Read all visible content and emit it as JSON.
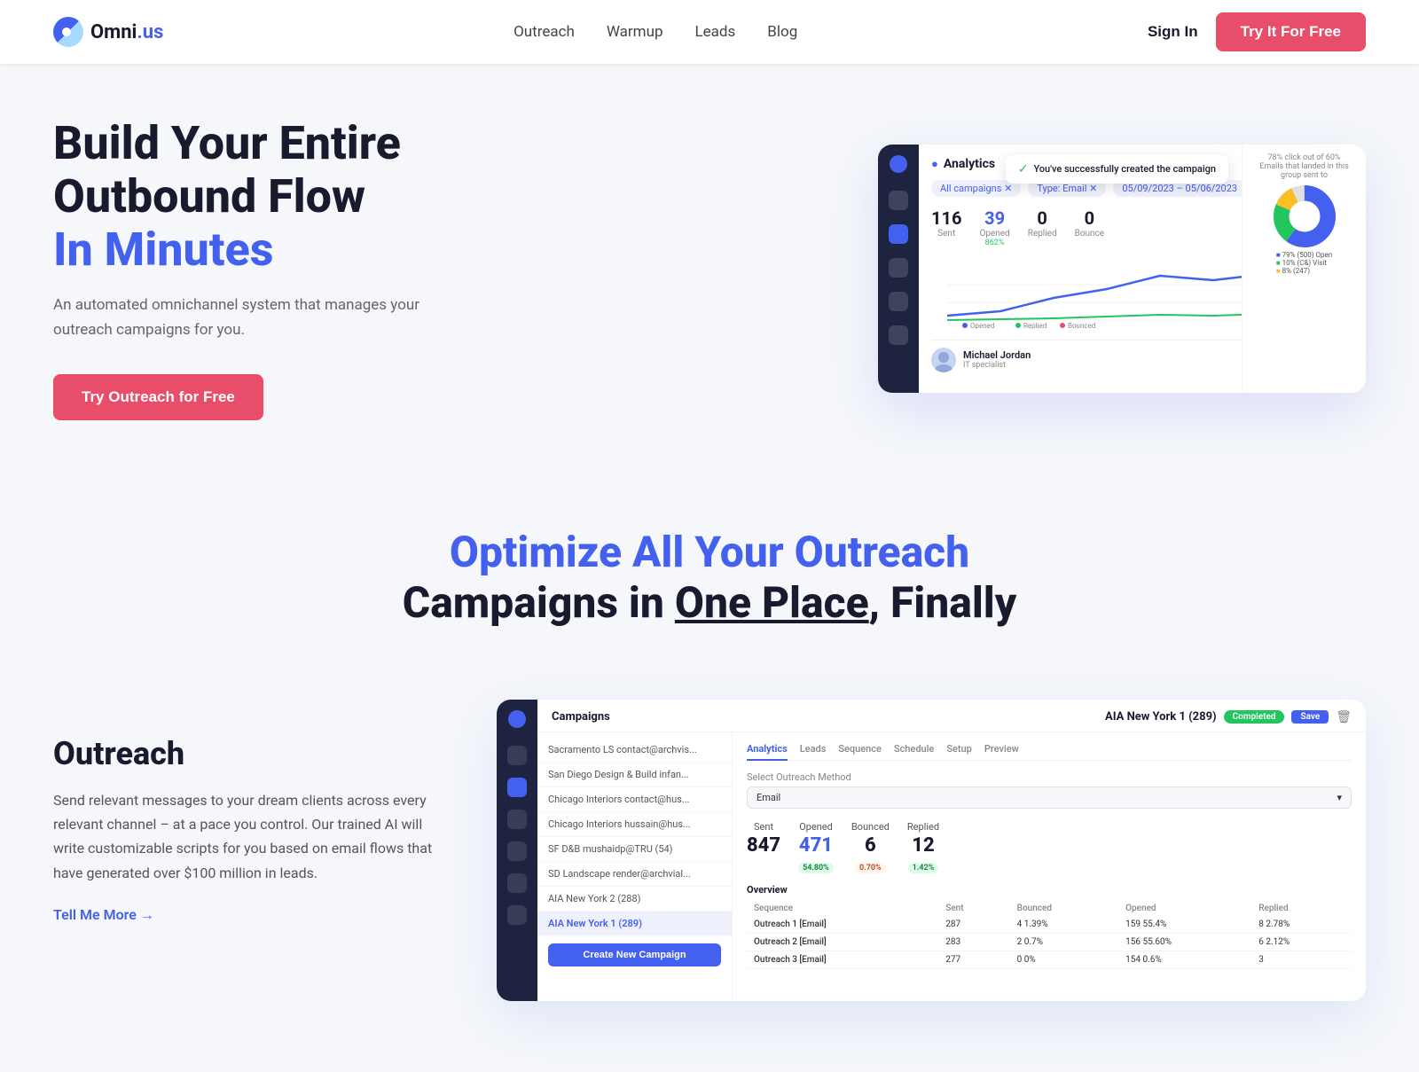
{
  "brand": {
    "name_part1": "Omni",
    "name_part2": ".us"
  },
  "navbar": {
    "links": [
      {
        "label": "Outreach",
        "key": "outreach"
      },
      {
        "label": "Warmup",
        "key": "warmup"
      },
      {
        "label": "Leads",
        "key": "leads"
      },
      {
        "label": "Blog",
        "key": "blog"
      }
    ],
    "signin_label": "Sign In",
    "cta_label": "Try It For Free"
  },
  "hero": {
    "title_line1": "Build Your Entire",
    "title_line2": "Outbound Flow",
    "title_line3": "In Minutes",
    "subtitle": "An automated omnichannel system that manages your outreach campaigns for you.",
    "cta_label": "Try Outreach for Free",
    "toast_text": "You've successfully created the campaign",
    "analytics_label": "Analytics",
    "stats": [
      {
        "num": "116",
        "label": "Sent"
      },
      {
        "num": "39",
        "label": "Opened",
        "pct": "862%"
      },
      {
        "num": "0",
        "label": "Replied"
      },
      {
        "num": "0",
        "label": "Bounce"
      }
    ]
  },
  "section2": {
    "title_colored": "Optimize All Your Outreach",
    "title_plain": "Campaigns in ",
    "title_underline": "One Place",
    "title_end": ", Finally"
  },
  "outreach": {
    "heading": "Outreach",
    "description": "Send relevant messages to your dream clients across every relevant channel – at a pace you control. Our trained AI will write customizable scripts for you based on email flows that have generated over $100 million in leads.",
    "tell_more": "Tell Me More →",
    "dashboard": {
      "campaign_title": "AIA New York 1 (289)",
      "completed_label": "Completed",
      "save_label": "Save",
      "tabs": [
        "Analytics",
        "Leads",
        "Sequence",
        "Schedule",
        "Setup",
        "Preview"
      ],
      "method_label": "Select Outreach Method",
      "method_value": "Email",
      "metrics": [
        {
          "num": "847",
          "label": "Sent",
          "badge": null
        },
        {
          "num": "471",
          "label": "Opened",
          "pct": "54.80%",
          "color": "green"
        },
        {
          "num": "6",
          "label": "Bounced",
          "pct": "0.70%",
          "color": "orange"
        },
        {
          "num": "12",
          "label": "Replied",
          "pct": "1.42%",
          "color": "green"
        }
      ],
      "overview_title": "Overview",
      "table_headers": [
        "Sequence",
        "Sent",
        "Bounced",
        "Opened",
        "Replied"
      ],
      "table_rows": [
        {
          "name": "Outreach 1 [Email]",
          "sent": "287",
          "bounced": "4 1.39%",
          "opened": "159 55.4%",
          "replied": "8 2.78%"
        },
        {
          "name": "Outreach 2 [Email]",
          "sent": "283",
          "bounced": "2 0.7%",
          "opened": "156 55.60%",
          "replied": "6 2.12%"
        },
        {
          "name": "Outreach 3 [Email]",
          "sent": "277",
          "bounced": "0 0%",
          "opened": "154 0.6%",
          "replied": "3"
        }
      ],
      "campaigns_list": [
        "Sacramento LS contact@archvis...",
        "San Diego Design & Build infan...",
        "Chicago Interiors contact@hus...",
        "Chicago Interiors hussain@hus...",
        "SF D&B mushaidp@TRU (54)",
        "SD Landscape render@archvial...",
        "AIA New York 2 (288)",
        "AIA New York 1 (289)"
      ],
      "create_btn": "Create New Campaign"
    }
  },
  "colors": {
    "blue": "#4361ee",
    "red": "#e84e6a",
    "dark": "#1a1a2e",
    "sidebar_bg": "#1e2340"
  }
}
